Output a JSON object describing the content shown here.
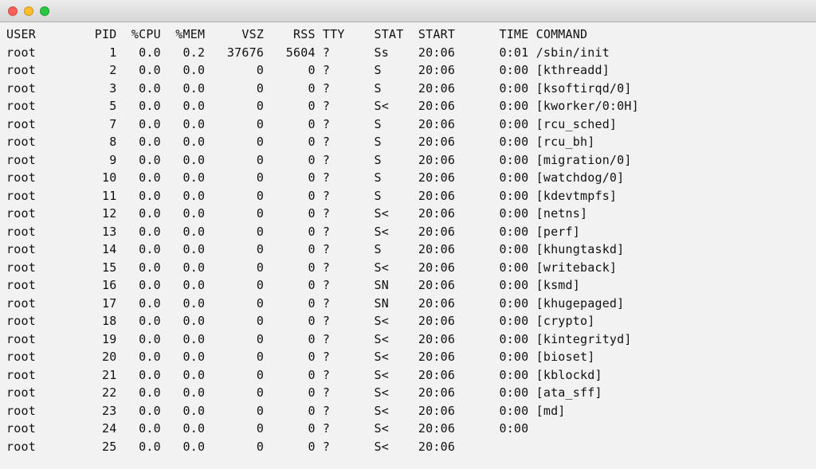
{
  "headers": {
    "user": "USER",
    "pid": "PID",
    "cpu": "%CPU",
    "mem": "%MEM",
    "vsz": "VSZ",
    "rss": "RSS",
    "tty": "TTY",
    "stat": "STAT",
    "start": "START",
    "time": "TIME",
    "command": "COMMAND"
  },
  "rows": [
    {
      "user": "root",
      "pid": "1",
      "cpu": "0.0",
      "mem": "0.2",
      "vsz": "37676",
      "rss": "5604",
      "tty": "?",
      "stat": "Ss",
      "start": "20:06",
      "time": "0:01",
      "command": "/sbin/init"
    },
    {
      "user": "root",
      "pid": "2",
      "cpu": "0.0",
      "mem": "0.0",
      "vsz": "0",
      "rss": "0",
      "tty": "?",
      "stat": "S",
      "start": "20:06",
      "time": "0:00",
      "command": "[kthreadd]"
    },
    {
      "user": "root",
      "pid": "3",
      "cpu": "0.0",
      "mem": "0.0",
      "vsz": "0",
      "rss": "0",
      "tty": "?",
      "stat": "S",
      "start": "20:06",
      "time": "0:00",
      "command": "[ksoftirqd/0]"
    },
    {
      "user": "root",
      "pid": "5",
      "cpu": "0.0",
      "mem": "0.0",
      "vsz": "0",
      "rss": "0",
      "tty": "?",
      "stat": "S<",
      "start": "20:06",
      "time": "0:00",
      "command": "[kworker/0:0H]"
    },
    {
      "user": "root",
      "pid": "7",
      "cpu": "0.0",
      "mem": "0.0",
      "vsz": "0",
      "rss": "0",
      "tty": "?",
      "stat": "S",
      "start": "20:06",
      "time": "0:00",
      "command": "[rcu_sched]"
    },
    {
      "user": "root",
      "pid": "8",
      "cpu": "0.0",
      "mem": "0.0",
      "vsz": "0",
      "rss": "0",
      "tty": "?",
      "stat": "S",
      "start": "20:06",
      "time": "0:00",
      "command": "[rcu_bh]"
    },
    {
      "user": "root",
      "pid": "9",
      "cpu": "0.0",
      "mem": "0.0",
      "vsz": "0",
      "rss": "0",
      "tty": "?",
      "stat": "S",
      "start": "20:06",
      "time": "0:00",
      "command": "[migration/0]"
    },
    {
      "user": "root",
      "pid": "10",
      "cpu": "0.0",
      "mem": "0.0",
      "vsz": "0",
      "rss": "0",
      "tty": "?",
      "stat": "S",
      "start": "20:06",
      "time": "0:00",
      "command": "[watchdog/0]"
    },
    {
      "user": "root",
      "pid": "11",
      "cpu": "0.0",
      "mem": "0.0",
      "vsz": "0",
      "rss": "0",
      "tty": "?",
      "stat": "S",
      "start": "20:06",
      "time": "0:00",
      "command": "[kdevtmpfs]"
    },
    {
      "user": "root",
      "pid": "12",
      "cpu": "0.0",
      "mem": "0.0",
      "vsz": "0",
      "rss": "0",
      "tty": "?",
      "stat": "S<",
      "start": "20:06",
      "time": "0:00",
      "command": "[netns]"
    },
    {
      "user": "root",
      "pid": "13",
      "cpu": "0.0",
      "mem": "0.0",
      "vsz": "0",
      "rss": "0",
      "tty": "?",
      "stat": "S<",
      "start": "20:06",
      "time": "0:00",
      "command": "[perf]"
    },
    {
      "user": "root",
      "pid": "14",
      "cpu": "0.0",
      "mem": "0.0",
      "vsz": "0",
      "rss": "0",
      "tty": "?",
      "stat": "S",
      "start": "20:06",
      "time": "0:00",
      "command": "[khungtaskd]"
    },
    {
      "user": "root",
      "pid": "15",
      "cpu": "0.0",
      "mem": "0.0",
      "vsz": "0",
      "rss": "0",
      "tty": "?",
      "stat": "S<",
      "start": "20:06",
      "time": "0:00",
      "command": "[writeback]"
    },
    {
      "user": "root",
      "pid": "16",
      "cpu": "0.0",
      "mem": "0.0",
      "vsz": "0",
      "rss": "0",
      "tty": "?",
      "stat": "SN",
      "start": "20:06",
      "time": "0:00",
      "command": "[ksmd]"
    },
    {
      "user": "root",
      "pid": "17",
      "cpu": "0.0",
      "mem": "0.0",
      "vsz": "0",
      "rss": "0",
      "tty": "?",
      "stat": "SN",
      "start": "20:06",
      "time": "0:00",
      "command": "[khugepaged]"
    },
    {
      "user": "root",
      "pid": "18",
      "cpu": "0.0",
      "mem": "0.0",
      "vsz": "0",
      "rss": "0",
      "tty": "?",
      "stat": "S<",
      "start": "20:06",
      "time": "0:00",
      "command": "[crypto]"
    },
    {
      "user": "root",
      "pid": "19",
      "cpu": "0.0",
      "mem": "0.0",
      "vsz": "0",
      "rss": "0",
      "tty": "?",
      "stat": "S<",
      "start": "20:06",
      "time": "0:00",
      "command": "[kintegrityd]"
    },
    {
      "user": "root",
      "pid": "20",
      "cpu": "0.0",
      "mem": "0.0",
      "vsz": "0",
      "rss": "0",
      "tty": "?",
      "stat": "S<",
      "start": "20:06",
      "time": "0:00",
      "command": "[bioset]"
    },
    {
      "user": "root",
      "pid": "21",
      "cpu": "0.0",
      "mem": "0.0",
      "vsz": "0",
      "rss": "0",
      "tty": "?",
      "stat": "S<",
      "start": "20:06",
      "time": "0:00",
      "command": "[kblockd]"
    },
    {
      "user": "root",
      "pid": "22",
      "cpu": "0.0",
      "mem": "0.0",
      "vsz": "0",
      "rss": "0",
      "tty": "?",
      "stat": "S<",
      "start": "20:06",
      "time": "0:00",
      "command": "[ata_sff]"
    },
    {
      "user": "root",
      "pid": "23",
      "cpu": "0.0",
      "mem": "0.0",
      "vsz": "0",
      "rss": "0",
      "tty": "?",
      "stat": "S<",
      "start": "20:06",
      "time": "0:00",
      "command": "[md]"
    },
    {
      "user": "root",
      "pid": "24",
      "cpu": "0.0",
      "mem": "0.0",
      "vsz": "0",
      "rss": "0",
      "tty": "?",
      "stat": "S<",
      "start": "20:06",
      "time": "0:00",
      "command": ""
    },
    {
      "user": "root",
      "pid": "25",
      "cpu": "0.0",
      "mem": "0.0",
      "vsz": "0",
      "rss": "0",
      "tty": "?",
      "stat": "S<",
      "start": "20:06",
      "time": "",
      "command": ""
    }
  ],
  "col_widths": {
    "user": 10,
    "pid": 5,
    "cpu": 5,
    "mem": 5,
    "vsz": 7,
    "rss": 6,
    "tty": 4,
    "stat": 5,
    "start": 6,
    "time": 6,
    "command": 0
  }
}
